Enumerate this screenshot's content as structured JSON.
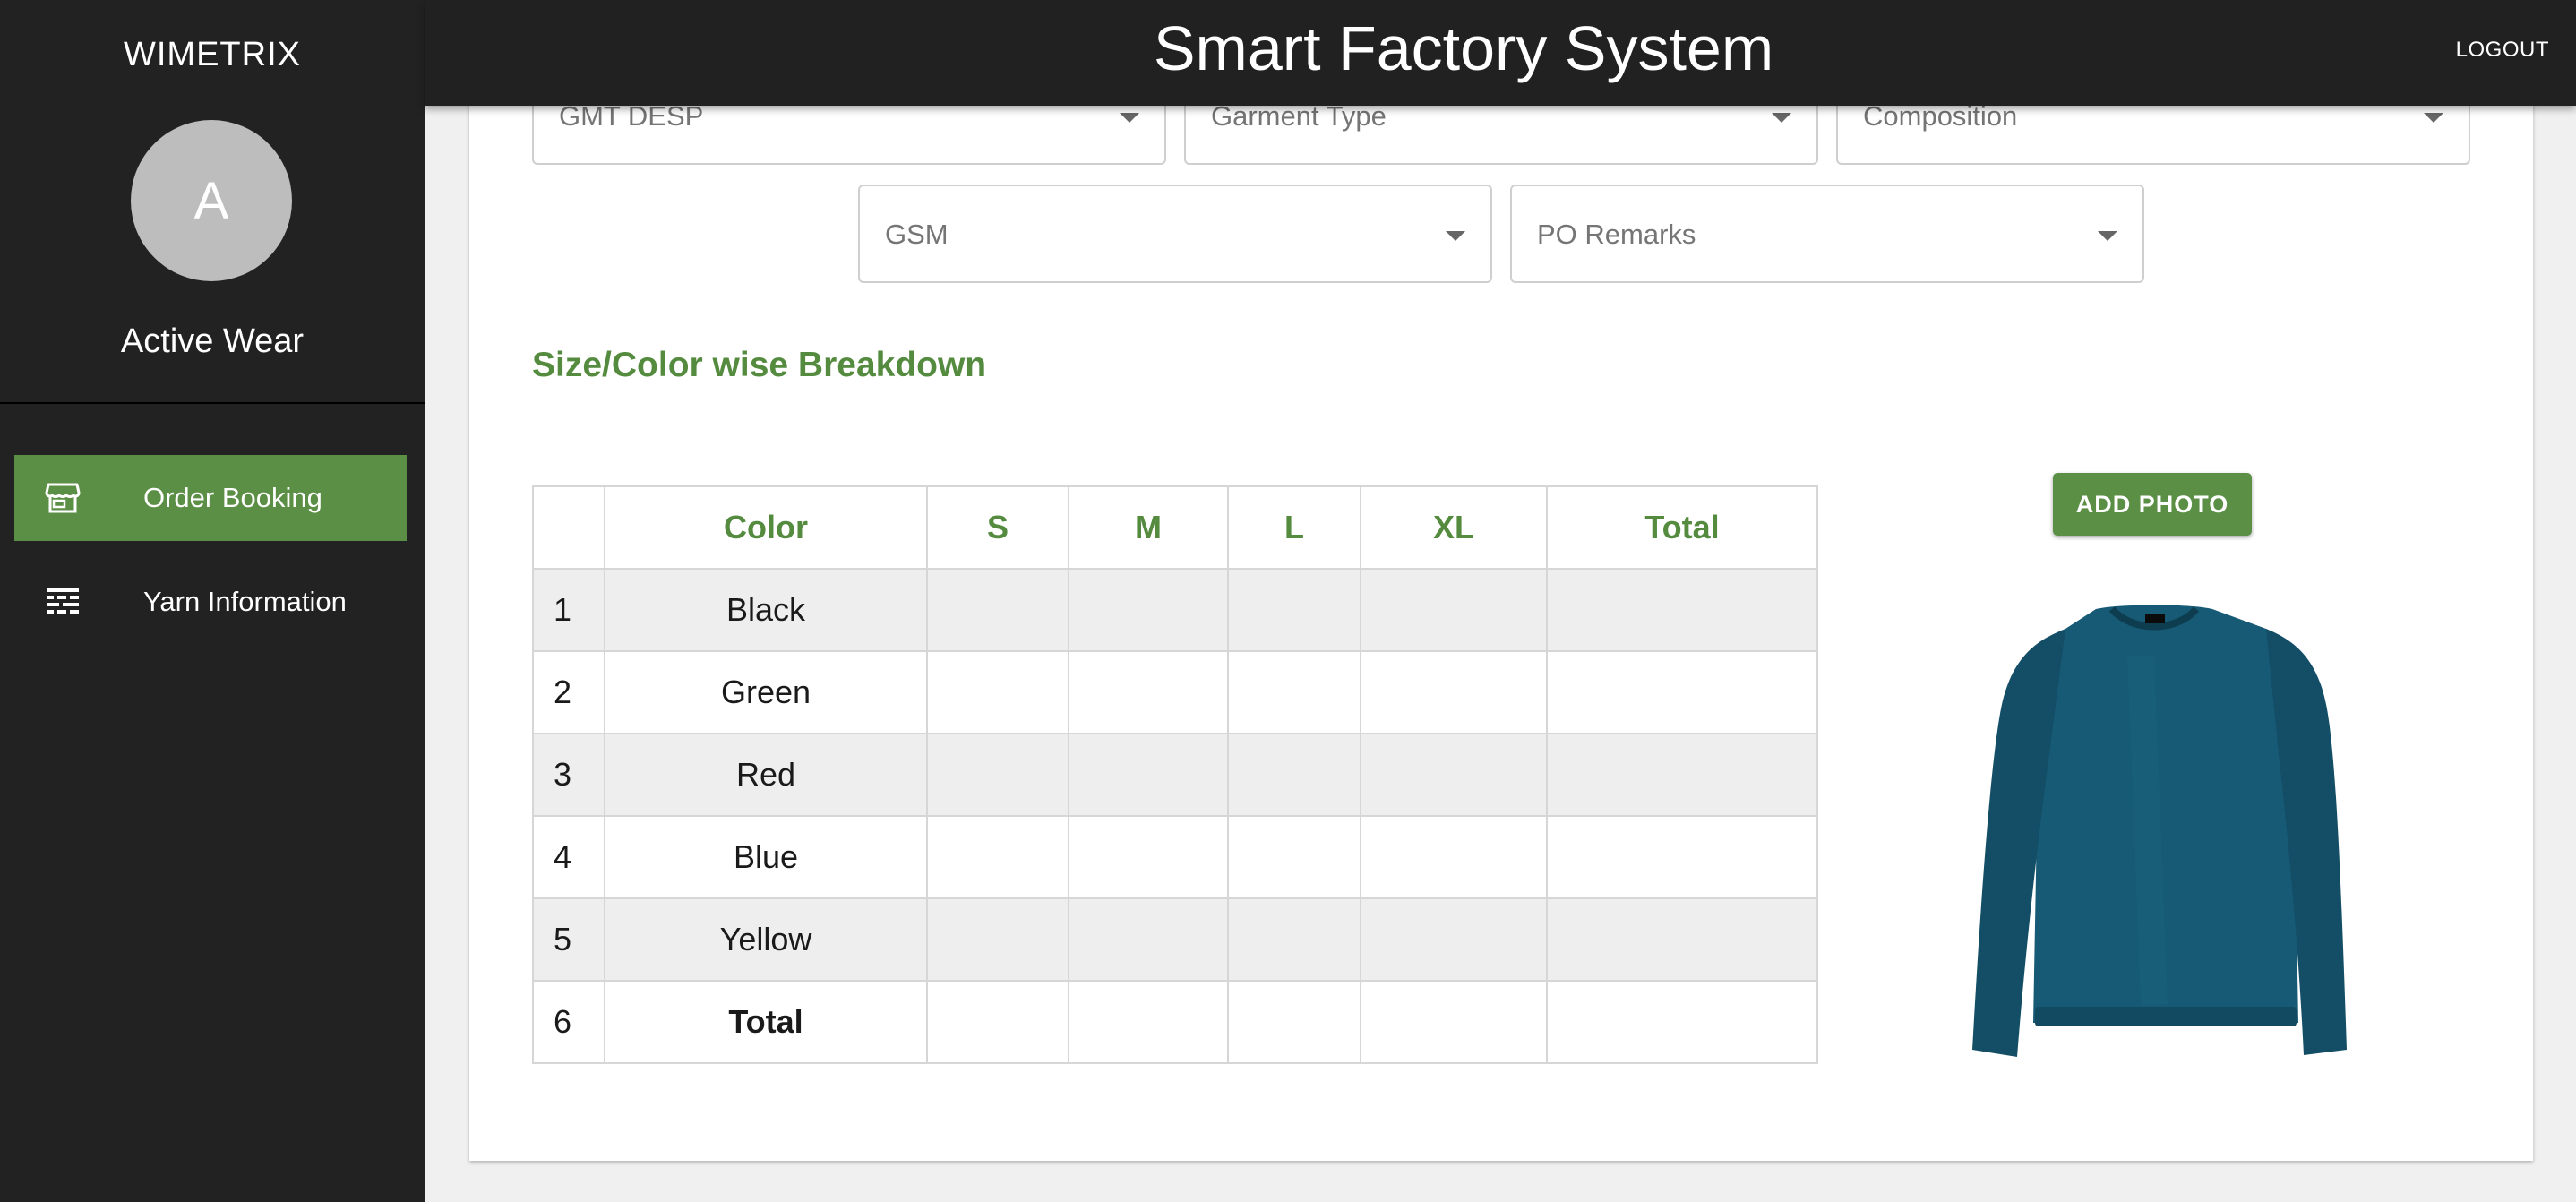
{
  "sidebar": {
    "brand": "WIMETRIX",
    "avatar_letter": "A",
    "user_name": "Active Wear",
    "items": [
      {
        "label": "Order Booking",
        "icon": "store-icon",
        "active": true
      },
      {
        "label": "Yarn Information",
        "icon": "yarn-list-icon",
        "active": false
      }
    ]
  },
  "header": {
    "title": "Smart Factory System",
    "logout_label": "LOGOUT"
  },
  "form": {
    "gmt_desp_label": "GMT DESP",
    "garment_type_label": "Garment Type",
    "composition_label": "Composition",
    "gsm_label": "GSM",
    "po_remarks_label": "PO Remarks"
  },
  "breakdown": {
    "title": "Size/Color wise Breakdown",
    "columns": [
      "",
      "Color",
      "S",
      "M",
      "L",
      "XL",
      "Total"
    ],
    "rows": [
      {
        "index": "1",
        "color": "Black",
        "s": "",
        "m": "",
        "l": "",
        "xl": "",
        "total": ""
      },
      {
        "index": "2",
        "color": "Green",
        "s": "",
        "m": "",
        "l": "",
        "xl": "",
        "total": ""
      },
      {
        "index": "3",
        "color": "Red",
        "s": "",
        "m": "",
        "l": "",
        "xl": "",
        "total": ""
      },
      {
        "index": "4",
        "color": "Blue",
        "s": "",
        "m": "",
        "l": "",
        "xl": "",
        "total": ""
      },
      {
        "index": "5",
        "color": "Yellow",
        "s": "",
        "m": "",
        "l": "",
        "xl": "",
        "total": ""
      },
      {
        "index": "6",
        "color": "Total",
        "s": "",
        "m": "",
        "l": "",
        "xl": "",
        "total": ""
      }
    ]
  },
  "photo": {
    "add_label": "ADD PHOTO",
    "image": "sweater-image"
  },
  "colors": {
    "accent_green": "#5b8f45",
    "header_bg": "#212121",
    "sidebar_bg": "#222222",
    "garment_teal": "#175a75"
  }
}
